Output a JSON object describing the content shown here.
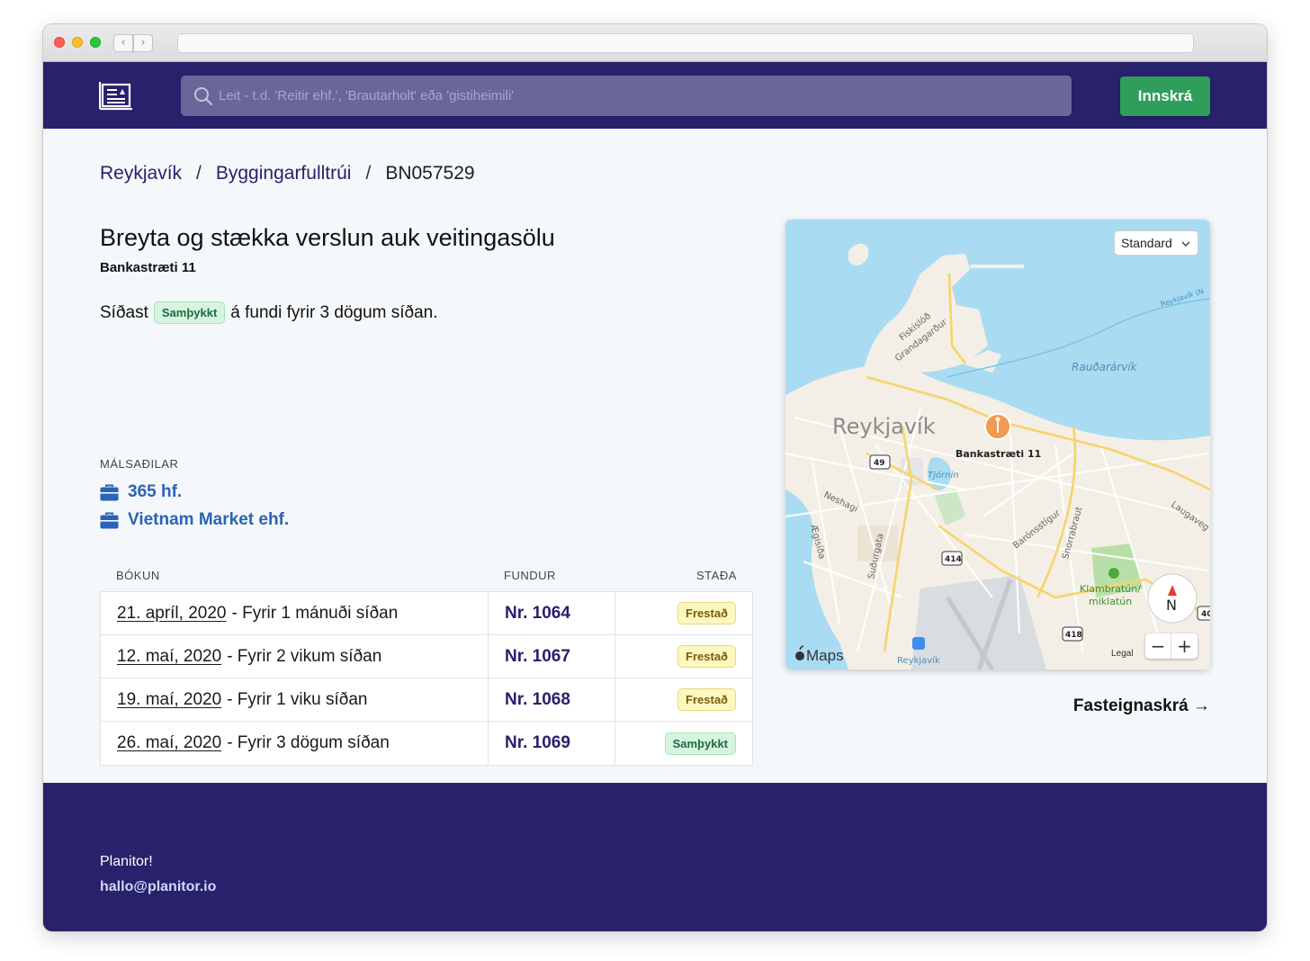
{
  "header": {
    "search_placeholder": "Leit - t.d. 'Reitir ehf.', 'Brautarholt' eða 'gistiheimili'",
    "login_label": "Innskrá"
  },
  "breadcrumb": {
    "city": "Reykjavík",
    "office": "Byggingarfulltrúi",
    "case_id": "BN057529",
    "separator": "/"
  },
  "case": {
    "title": "Breyta og stækka verslun auk veitingasölu",
    "address": "Bankastræti 11",
    "status_prefix": "Síðast",
    "status_badge": "Samþykkt",
    "status_suffix": "á fundi fyrir 3 dögum síðan."
  },
  "parties": {
    "label": "MÁLSAÐILAR",
    "items": [
      {
        "name": "365 hf.",
        "icon": "briefcase-icon"
      },
      {
        "name": "Vietnam Market ehf.",
        "icon": "briefcase-icon"
      }
    ]
  },
  "table": {
    "headers": {
      "booking": "BÓKUN",
      "meeting": "FUNDUR",
      "status": "STAÐA"
    },
    "rows": [
      {
        "date": "21. apríl, 2020",
        "relative": "- Fyrir 1 mánuði síðan",
        "meeting": "Nr. 1064",
        "status": "Frestað",
        "status_type": "yellow"
      },
      {
        "date": "12. maí, 2020",
        "relative": "- Fyrir 2 vikum síðan",
        "meeting": "Nr. 1067",
        "status": "Frestað",
        "status_type": "yellow"
      },
      {
        "date": "19. maí, 2020",
        "relative": "- Fyrir 1 viku síðan",
        "meeting": "Nr. 1068",
        "status": "Frestað",
        "status_type": "yellow"
      },
      {
        "date": "26. maí, 2020",
        "relative": "- Fyrir 3 dögum síðan",
        "meeting": "Nr. 1069",
        "status": "Samþykkt",
        "status_type": "green"
      }
    ]
  },
  "map": {
    "type_select": "Standard",
    "city_label": "Reykjavík",
    "pin_label": "Bankastræti 11",
    "water_label": "Rauðarárvík",
    "lake_label": "Tjörnin",
    "park_label_1": "Klambratún/",
    "park_label_2": "miklatún",
    "streets": [
      "Fiskislóð",
      "Grandagarður",
      "Neshagi",
      "Ægisíða",
      "Suðurgata",
      "Barónsstígur",
      "Snorrabraut",
      "Laugaveg",
      "Reykjavík (N"
    ],
    "road_numbers": [
      "49",
      "414",
      "418",
      "40"
    ],
    "airport_label": "Reykjavík",
    "compass": "N",
    "attribution": "Maps",
    "legal": "Legal",
    "zoom_out": "−",
    "zoom_in": "+"
  },
  "links": {
    "property_register": "Fasteignaskrá →"
  },
  "footer": {
    "brand": "Planitor!",
    "email": "hallo@planitor.io"
  },
  "colors": {
    "header_bg": "#28216b",
    "accent_green": "#2f9e5b",
    "link_blue": "#2a63b8"
  }
}
